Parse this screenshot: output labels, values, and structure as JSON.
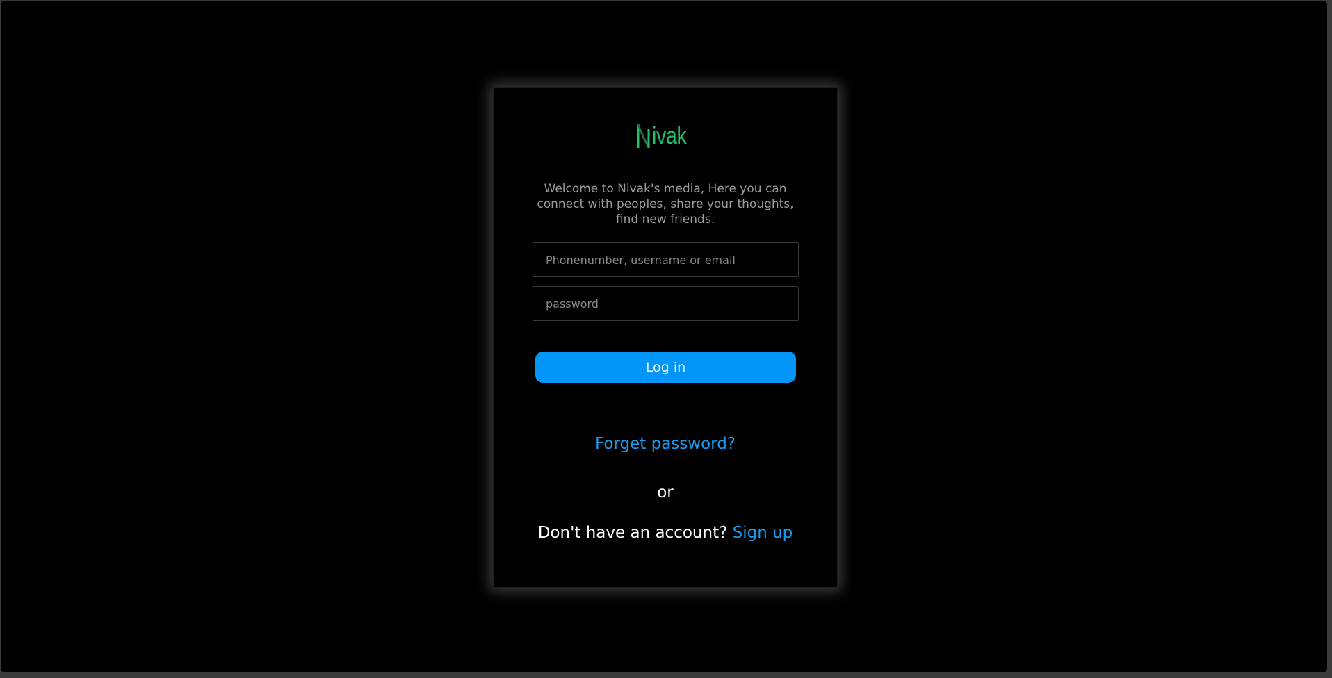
{
  "brand": {
    "logo_text": "ivak",
    "logo_letter": "N",
    "logo_color": "#1fc46a"
  },
  "welcome_text": "Welcome to Nivak's media, Here you can connect with peoples, share your thoughts, find new friends.",
  "form": {
    "identifier": {
      "placeholder": "Phonenumber, username or email",
      "value": ""
    },
    "password": {
      "placeholder": "password",
      "value": ""
    },
    "login_label": "Log in"
  },
  "links": {
    "forgot_password": "Forget password?",
    "or_text": "or",
    "no_account_text": "Don't have an account?",
    "signup_label": "Sign up"
  },
  "colors": {
    "background": "#000000",
    "accent": "#0095f6",
    "link": "#1a9bf0",
    "muted_text": "#9c9c9c"
  }
}
